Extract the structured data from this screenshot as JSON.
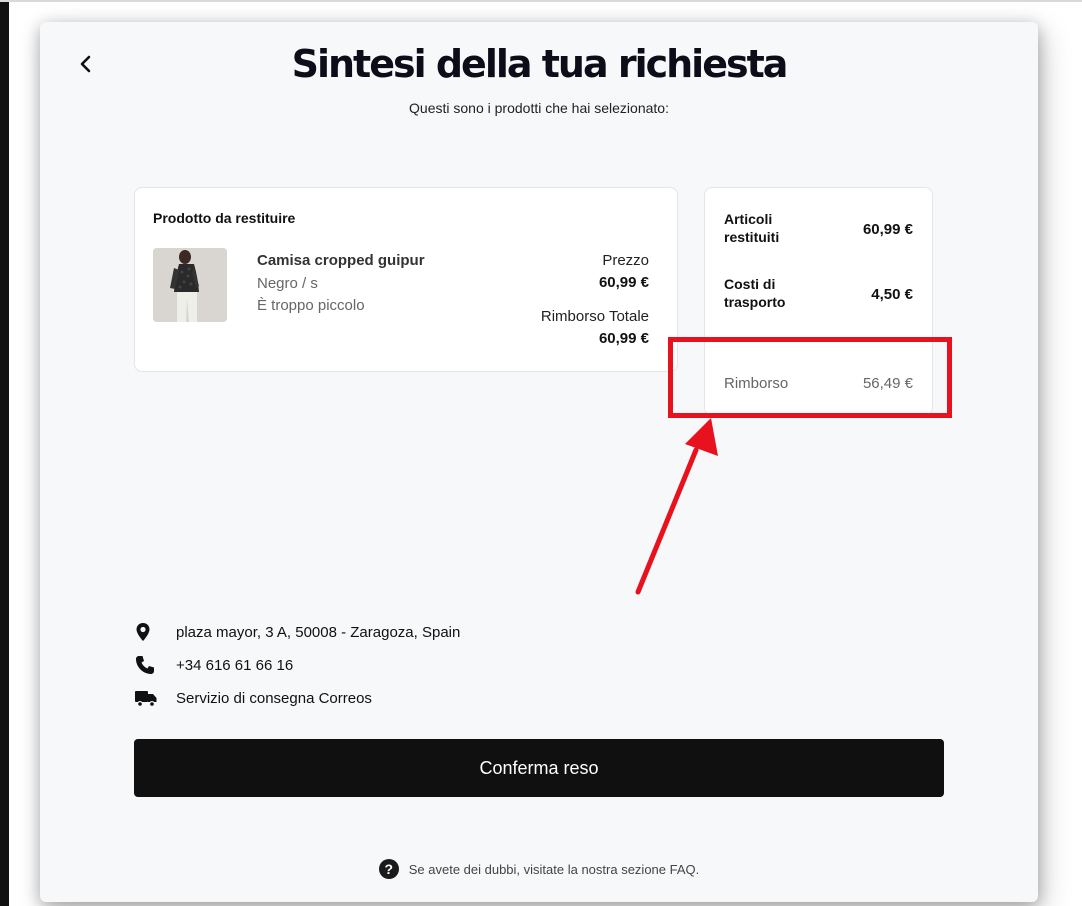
{
  "page": {
    "title": "Sintesi della tua richiesta",
    "subtitle": "Questi sono i prodotti che hai selezionato:",
    "back_icon": "chevron-left-icon"
  },
  "product_card": {
    "title": "Prodotto da restituire",
    "product": {
      "name": "Camisa cropped guipur",
      "variant": "Negro / s",
      "reason": "È troppo piccolo",
      "price_label": "Prezzo",
      "price": "60,99 €",
      "refund_label": "Rimborso Totale",
      "refund": "60,99 €"
    }
  },
  "summary": {
    "returned_label": "Articoli restituiti",
    "returned_value": "60,99 €",
    "shipping_label": "Costi di trasporto",
    "shipping_value": "4,50 €",
    "refund_label": "Rimborso",
    "refund_value": "56,49 €"
  },
  "info": {
    "address": "plaza mayor, 3 A, 50008 - Zaragoza, Spain",
    "phone": "+34 616 61 66 16",
    "delivery": "Servizio di consegna Correos"
  },
  "confirm_label": "Conferma reso",
  "faq": {
    "text": "Se avete dei dubbi, visitate la nostra sezione FAQ.",
    "icon_glyph": "?"
  },
  "annotation": {
    "color": "#e8111e"
  }
}
